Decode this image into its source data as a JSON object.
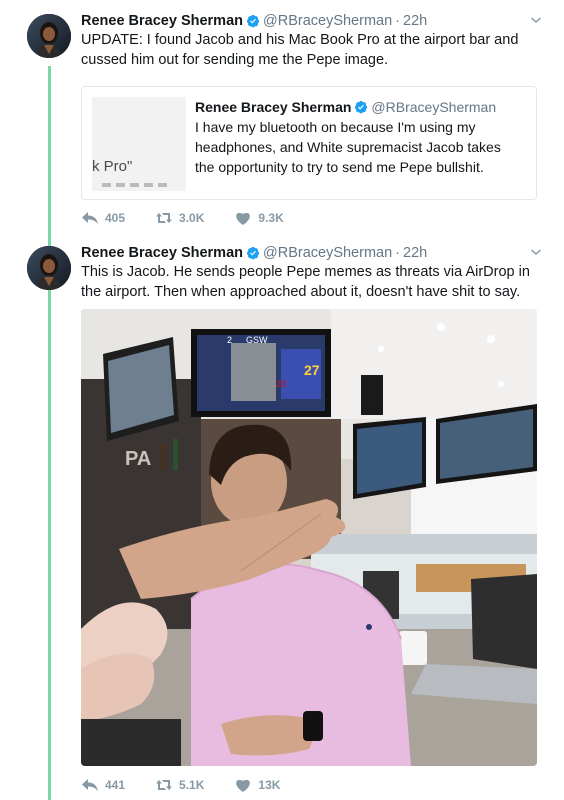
{
  "tweets": [
    {
      "author_name": "Renee Bracey Sherman",
      "author_handle": "@RBraceySherman",
      "timestamp": "22h",
      "text": "UPDATE: I found Jacob and his Mac Book Pro at the airport bar and cussed him out for sending me the Pepe image.",
      "quoted": {
        "author_name": "Renee Bracey Sherman",
        "author_handle": "@RBraceySherman",
        "text": "I have my bluetooth on because I'm using my headphones, and White supremacist Jacob takes the opportunity to try to send me Pepe bullshit.",
        "media_text": "k Pro\""
      },
      "replies": "405",
      "retweets": "3.0K",
      "likes": "9.3K"
    },
    {
      "author_name": "Renee Bracey Sherman",
      "author_handle": "@RBraceySherman",
      "timestamp": "22h",
      "text": "This is Jacob. He sends people Pepe memes as threats via AirDrop in the airport. Then when approached about it, doesn't have shit to say.",
      "photo": {
        "tv_score_text": "2",
        "tv_team_text": "GSW",
        "jersey_number": "27",
        "jersey_number_2": "23",
        "sign_text": "PA"
      },
      "replies": "441",
      "retweets": "5.1K",
      "likes": "13K"
    }
  ],
  "colors": {
    "thread_line": "#7ad8a6",
    "verified": "#1da1f2",
    "muted_text": "#657786",
    "action_icon": "#8899a6"
  }
}
